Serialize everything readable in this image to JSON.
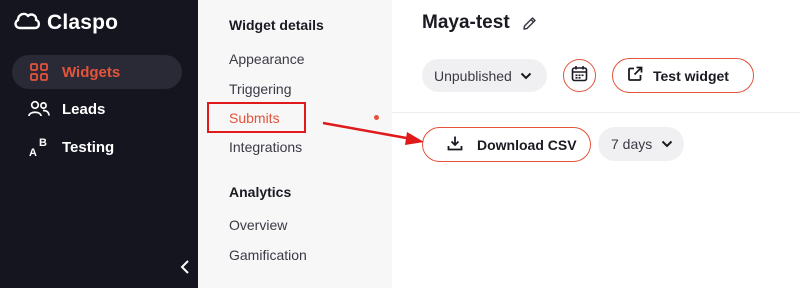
{
  "brand": {
    "name": "Claspo",
    "accent_color": "#e4533a",
    "sidebar_color": "#15151f",
    "annotation_color": "#e01a1a"
  },
  "sidebar": {
    "items": [
      {
        "label": "Widgets",
        "icon": "grid-icon",
        "active": true
      },
      {
        "label": "Leads",
        "icon": "users-icon",
        "active": false
      },
      {
        "label": "Testing",
        "icon": "ab-test-icon",
        "active": false
      }
    ],
    "collapse_icon": "chevron-left-icon"
  },
  "subnav": {
    "widget_details_heading": "Widget details",
    "widget_details_items": [
      "Appearance",
      "Triggering",
      "Submits",
      "Integrations"
    ],
    "analytics_heading": "Analytics",
    "analytics_items": [
      "Overview",
      "Gamification"
    ],
    "selected_item": "Submits"
  },
  "main": {
    "title": "Maya-test",
    "edit_icon": "pencil-icon",
    "status": "Unpublished",
    "calendar_icon": "calendar-icon",
    "test_widget_label": "Test widget",
    "test_widget_icon": "external-link-icon",
    "download_label": "Download CSV",
    "download_icon": "download-icon",
    "period": "7 days"
  }
}
